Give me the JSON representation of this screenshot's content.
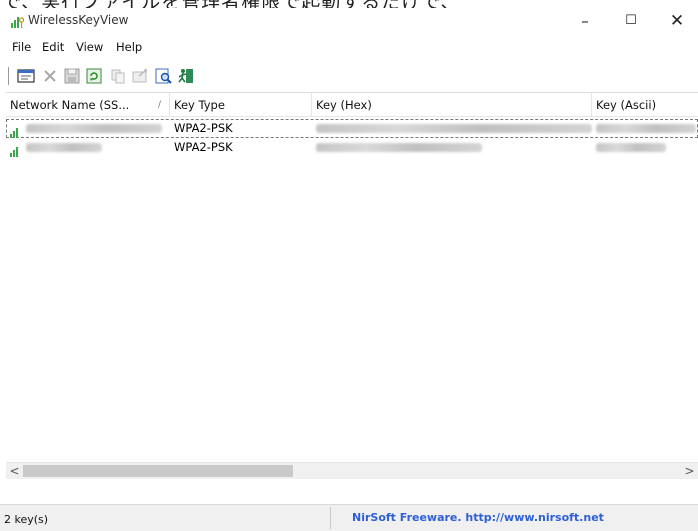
{
  "caption": "で、実行ファイルを管理者権限で起動するだけで、",
  "window": {
    "title": "WirelessKeyView",
    "minimize": "–",
    "maximize": "☐",
    "close": "✕"
  },
  "menu": [
    {
      "label": "File"
    },
    {
      "label": "Edit"
    },
    {
      "label": "View"
    },
    {
      "label": "Help"
    }
  ],
  "toolbar": [
    {
      "icon": "properties-icon"
    },
    {
      "icon": "delete-icon"
    },
    {
      "icon": "save-icon"
    },
    {
      "icon": "refresh-icon"
    },
    {
      "icon": "copy-icon"
    },
    {
      "icon": "export-icon"
    },
    {
      "icon": "find-icon"
    },
    {
      "icon": "exit-icon"
    }
  ],
  "columns": [
    {
      "label": "Network Name (SS...",
      "sort": "/"
    },
    {
      "label": "Key Type"
    },
    {
      "label": "Key (Hex)"
    },
    {
      "label": "Key (Ascii)"
    }
  ],
  "rows": [
    {
      "key_type": "WPA2-PSK",
      "selected": true
    },
    {
      "key_type": "WPA2-PSK",
      "selected": false
    }
  ],
  "scrollbar": {
    "left_arrow": "<",
    "right_arrow": ">"
  },
  "status": {
    "count": "2 key(s)",
    "link": "NirSoft Freeware.  http://www.nirsoft.net"
  },
  "colors": {
    "link": "#2e5fd6",
    "network_icon": "#3aa84a"
  }
}
